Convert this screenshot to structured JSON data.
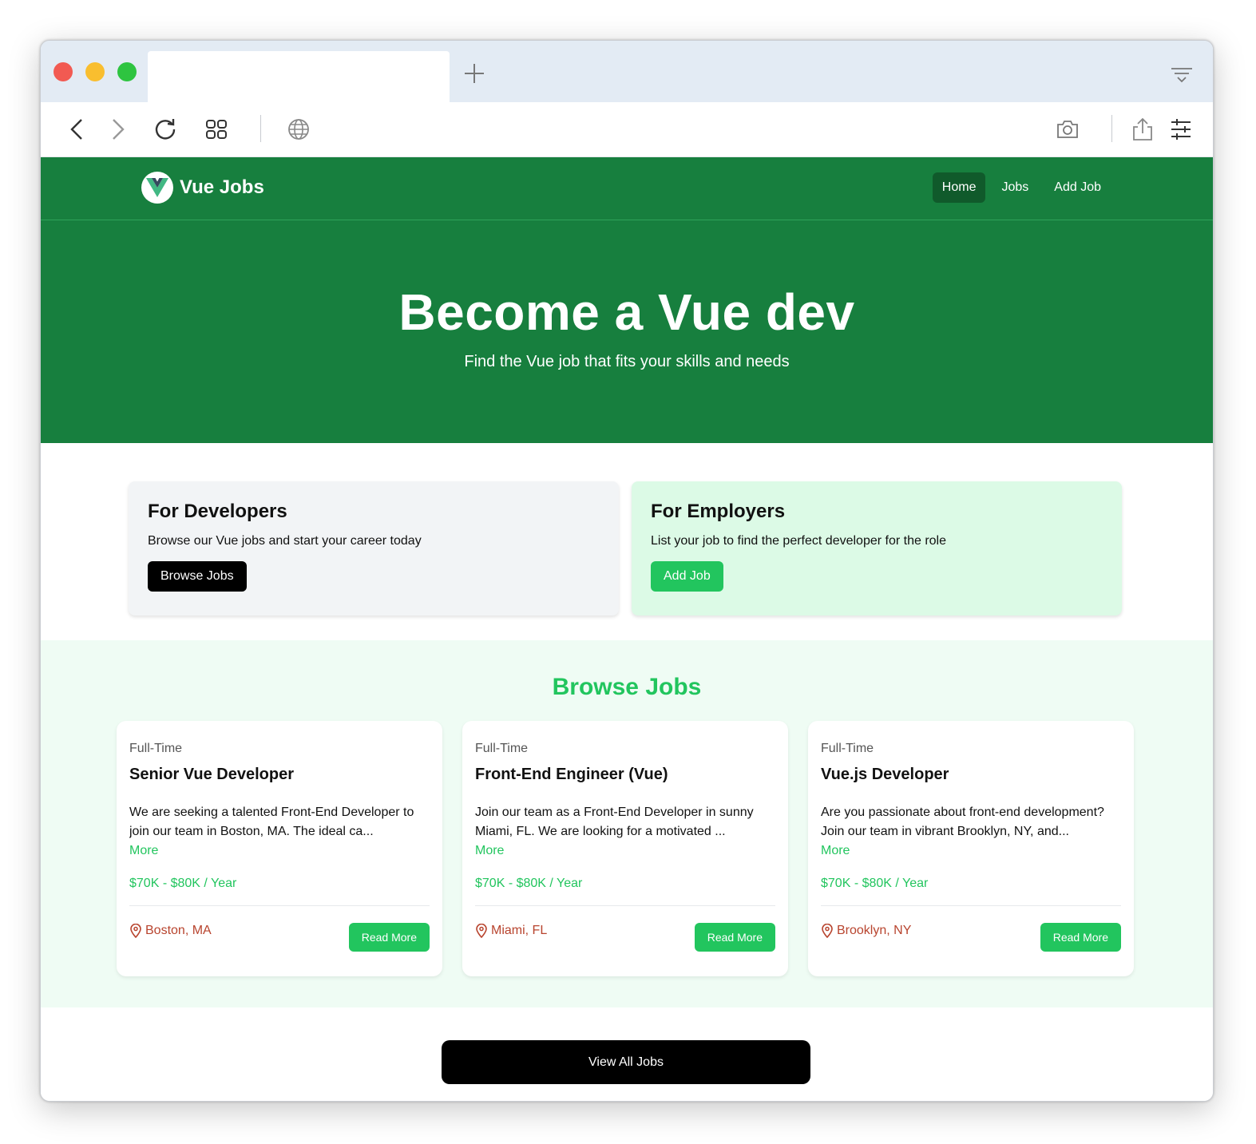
{
  "browser": {
    "active_tab_title": "",
    "icons": [
      "back-icon",
      "forward-icon",
      "reload-icon",
      "tabs-grid-icon",
      "globe-icon",
      "camera-icon",
      "share-icon",
      "settings-sliders-icon",
      "plus-icon",
      "tab-menu-icon"
    ]
  },
  "nav": {
    "brand": "Vue Jobs",
    "links": [
      {
        "label": "Home",
        "active": true
      },
      {
        "label": "Jobs",
        "active": false
      },
      {
        "label": "Add Job",
        "active": false
      }
    ]
  },
  "hero": {
    "title": "Become a Vue dev",
    "subtitle": "Find the Vue job that fits your skills and needs"
  },
  "cards": {
    "developers": {
      "title": "For Developers",
      "text": "Browse our Vue jobs and start your career today",
      "button": "Browse Jobs"
    },
    "employers": {
      "title": "For Employers",
      "text": "List your job to find the perfect developer for the role",
      "button": "Add Job"
    }
  },
  "browse": {
    "heading": "Browse Jobs",
    "jobs": [
      {
        "type": "Full-Time",
        "title": "Senior Vue Developer",
        "description": "We are seeking a talented Front-End Developer to join our team in Boston, MA. The ideal ca...",
        "more": "More",
        "salary": "$70K - $80K / Year",
        "location": "Boston, MA",
        "button": "Read More"
      },
      {
        "type": "Full-Time",
        "title": "Front-End Engineer (Vue)",
        "description": "Join our team as a Front-End Developer in sunny Miami, FL. We are looking for a motivated ...",
        "more": "More",
        "salary": "$70K - $80K / Year",
        "location": "Miami, FL",
        "button": "Read More"
      },
      {
        "type": "Full-Time",
        "title": "Vue.js Developer",
        "description": "Are you passionate about front-end development? Join our team in vibrant Brooklyn, NY, and...",
        "more": "More",
        "salary": "$70K - $80K / Year",
        "location": "Brooklyn, NY",
        "button": "Read More"
      }
    ]
  },
  "view_all": "View All Jobs",
  "colors": {
    "brand_green": "#177f3e",
    "accent_green": "#22c55e",
    "location_red": "#b8442e"
  }
}
